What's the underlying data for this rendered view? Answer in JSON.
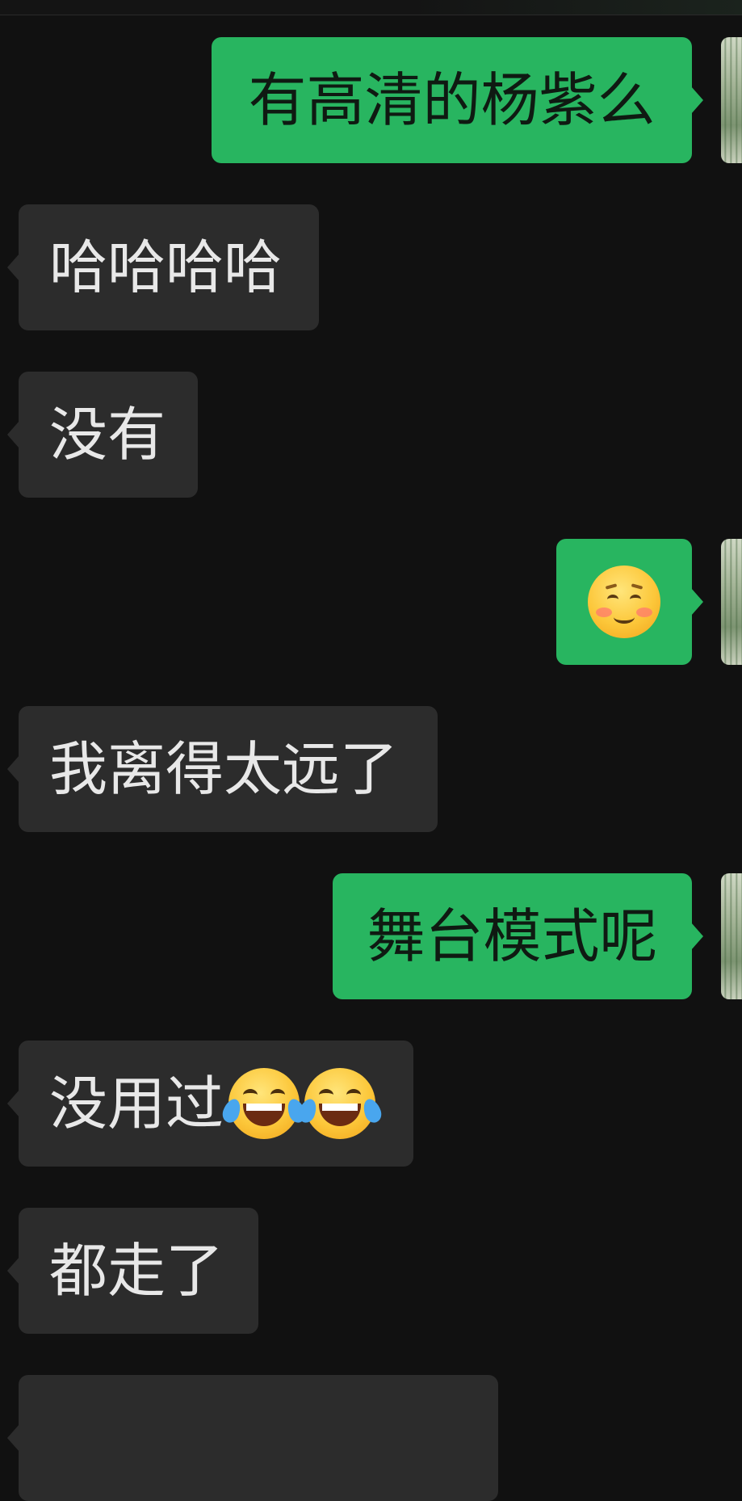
{
  "chat": {
    "messages": [
      {
        "direction": "out",
        "text": "有高清的杨紫么"
      },
      {
        "direction": "in",
        "text": "哈哈哈哈"
      },
      {
        "direction": "in",
        "text": "没有"
      },
      {
        "direction": "out",
        "emoji": "smiling-face-with-tear-icon"
      },
      {
        "direction": "in",
        "text": "我离得太远了"
      },
      {
        "direction": "out",
        "text": "舞台模式呢"
      },
      {
        "direction": "in",
        "text": "没用过",
        "emojis": [
          "face-with-tears-of-joy-icon",
          "face-with-tears-of-joy-icon"
        ]
      },
      {
        "direction": "in",
        "text": "都走了"
      },
      {
        "direction": "in",
        "text": ""
      }
    ]
  },
  "colors": {
    "background": "#111111",
    "incoming_bubble": "#2c2c2c",
    "outgoing_bubble": "#28b560"
  }
}
